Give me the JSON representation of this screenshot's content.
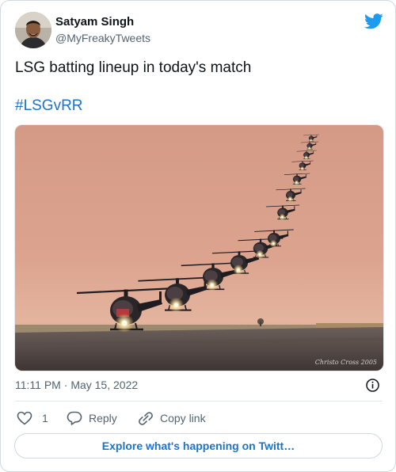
{
  "author": {
    "name": "Satyam Singh",
    "handle": "@MyFreakyTweets"
  },
  "tweet": {
    "text": "LSG batting lineup in today's match",
    "hashtag": "#LSGvRR",
    "image_credit": "Christo Cross 2005"
  },
  "meta": {
    "time": "11:11 PM",
    "separator": "·",
    "date": "May 15, 2022"
  },
  "actions": {
    "like_count": "1",
    "reply_label": "Reply",
    "copy_link_label": "Copy link"
  },
  "explore_label": "Explore what's happening on Twitt…",
  "colors": {
    "link": "#1d72c9",
    "twitter_blue": "#1d9bf0",
    "secondary_text": "#536471",
    "border": "#cfd9de"
  },
  "icons": {
    "logo": "twitter-bird-icon",
    "info": "info-icon",
    "like": "heart-icon",
    "reply": "reply-bubble-icon",
    "copy": "link-icon"
  }
}
